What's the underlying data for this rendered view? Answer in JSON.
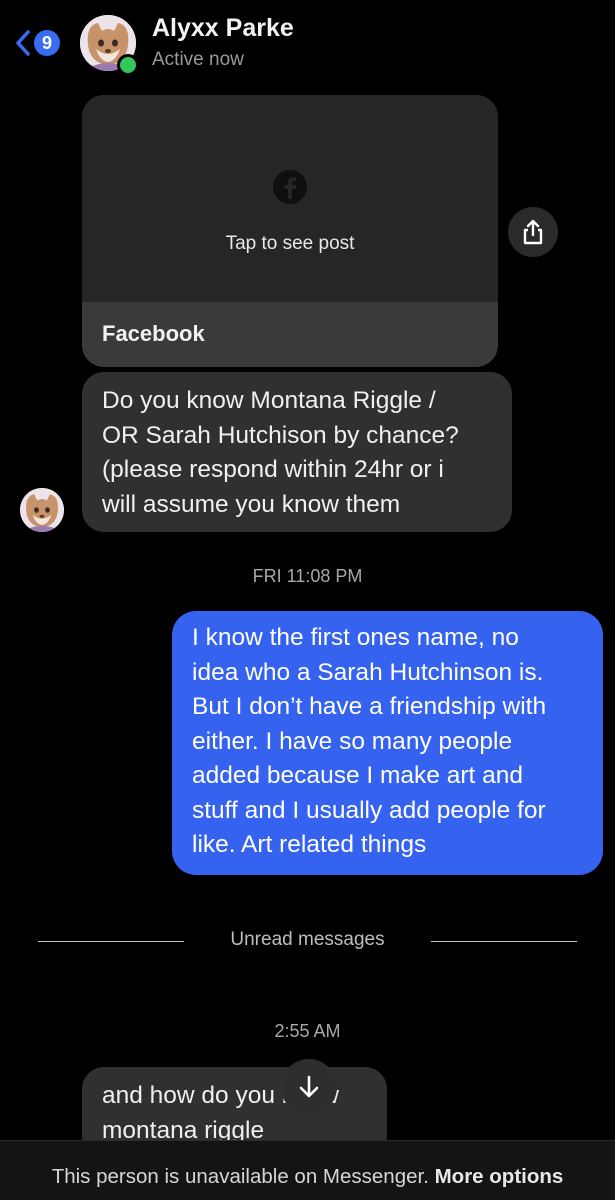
{
  "header": {
    "back_count": "9",
    "contact_name": "Alyxx Parke",
    "contact_status": "Active now"
  },
  "shared_post": {
    "prompt": "Tap to see post",
    "source": "Facebook"
  },
  "messages": {
    "received_1": [
      "Do you know Montana Riggle /",
      "OR Sarah Hutchison by chance?",
      "(please respond within 24hr or i",
      "will assume you know them"
    ],
    "timestamp_1": "FRI 11:08 PM",
    "sent_1": [
      "I know the first ones name, no",
      "idea who a Sarah Hutchinson is.",
      "But I don’t have a friendship with",
      "either. I have so many people",
      "added because I make art and",
      "stuff and I usually add people for",
      "like. Art related things"
    ],
    "unread_label": "Unread messages",
    "timestamp_2": "2:55 AM",
    "received_2": [
      "and how do you know",
      "montana riggle"
    ]
  },
  "footer": {
    "text": "This person is unavailable on Messenger.",
    "link": "More options"
  },
  "colors": {
    "sent_bubble": "#3563f0",
    "received_bubble": "#303032",
    "online": "#34c759",
    "badge": "#3a6cf2"
  }
}
